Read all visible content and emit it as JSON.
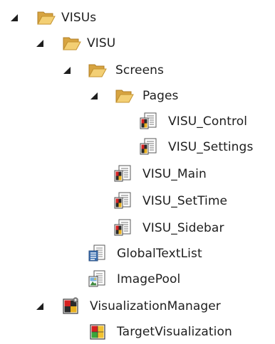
{
  "tree": {
    "nodes": [
      {
        "id": "visus",
        "label": "VISUs",
        "icon": "folder-open-icon",
        "expanded": true
      },
      {
        "id": "visu",
        "label": "VISU",
        "icon": "folder-open-icon",
        "expanded": true
      },
      {
        "id": "screens",
        "label": "Screens",
        "icon": "folder-open-icon",
        "expanded": true
      },
      {
        "id": "pages",
        "label": "Pages",
        "icon": "folder-open-icon",
        "expanded": true
      },
      {
        "id": "visu-control",
        "label": "VISU_Control",
        "icon": "visualization-icon"
      },
      {
        "id": "visu-settings",
        "label": "VISU_Settings",
        "icon": "visualization-icon"
      },
      {
        "id": "visu-main",
        "label": "VISU_Main",
        "icon": "visualization-icon"
      },
      {
        "id": "visu-settime",
        "label": "VISU_SetTime",
        "icon": "visualization-icon"
      },
      {
        "id": "visu-sidebar",
        "label": "VISU_Sidebar",
        "icon": "visualization-icon"
      },
      {
        "id": "globaltextlist",
        "label": "GlobalTextList",
        "icon": "text-list-icon"
      },
      {
        "id": "imagepool",
        "label": "ImagePool",
        "icon": "image-pool-icon"
      },
      {
        "id": "visualizationmanager",
        "label": "VisualizationManager",
        "icon": "visualization-manager-icon",
        "expanded": true
      },
      {
        "id": "targetvisualization",
        "label": "TargetVisualization",
        "icon": "target-visualization-icon"
      }
    ]
  }
}
